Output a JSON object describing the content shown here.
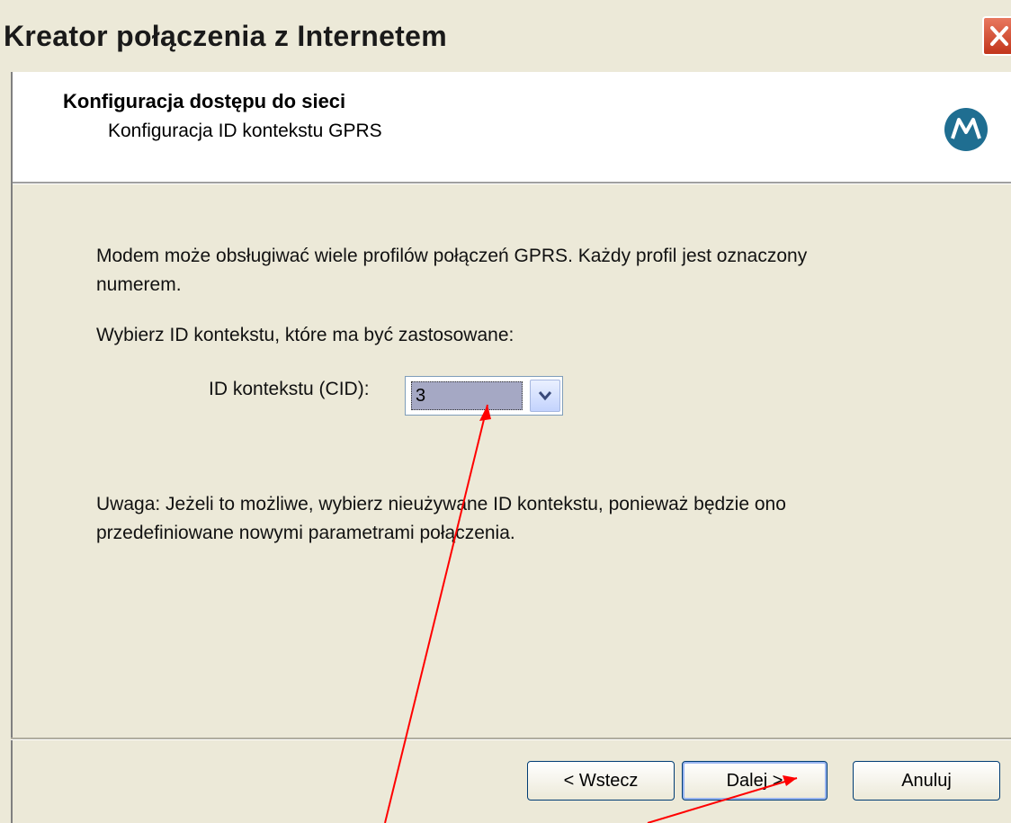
{
  "window": {
    "title": "Kreator połączenia z Internetem"
  },
  "header": {
    "title": "Konfiguracja dostępu do sieci",
    "subtitle": "Konfiguracja ID kontekstu GPRS",
    "logo_icon": "motorola-logo-icon"
  },
  "content": {
    "intro_line1": "Modem może obsługiwać wiele profilów połączeń GPRS. Każdy profil jest oznaczony",
    "intro_line2": "numerem.",
    "choose_text": "Wybierz ID kontekstu, które ma być zastosowane:",
    "cid_label": "ID kontekstu (CID):",
    "cid_value": "3",
    "note_line1": "Uwaga: Jeżeli to możliwe, wybierz nieużywane ID kontekstu, ponieważ będzie ono",
    "note_line2": "przedefiniowane nowymi parametrami połączenia."
  },
  "buttons": {
    "back_label": "< Wstecz",
    "next_label": "Dalej >",
    "cancel_label": "Anuluj"
  },
  "annotation_color": "#ff0000"
}
